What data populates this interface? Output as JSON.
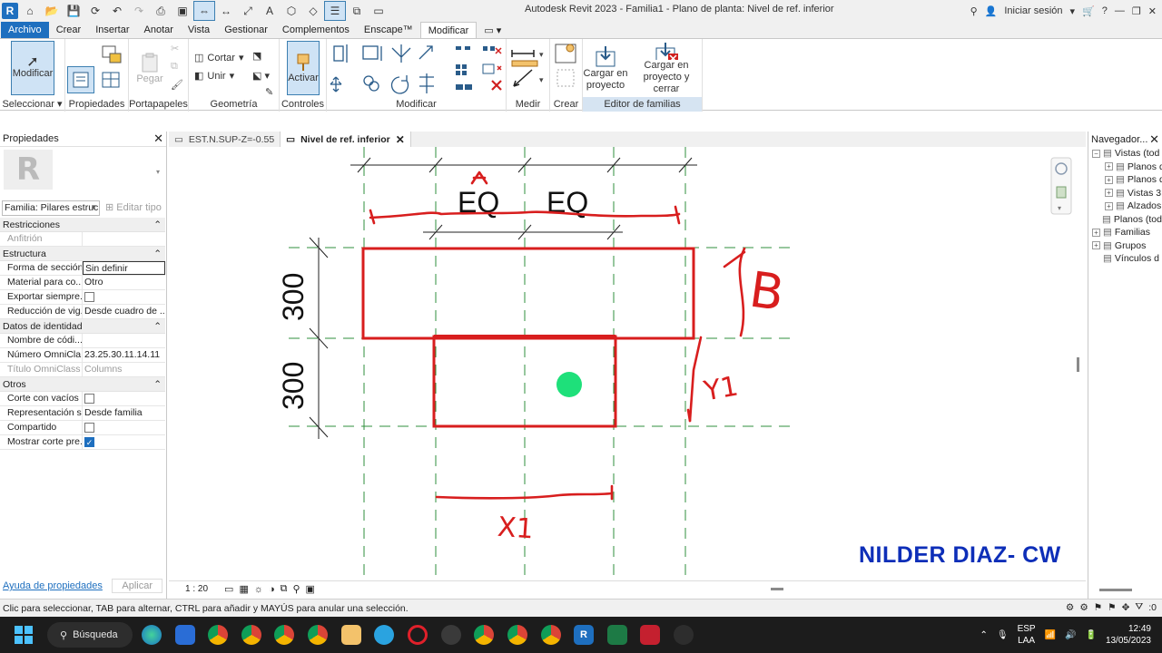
{
  "titlebar": {
    "title": "Autodesk Revit 2023 - Familia1 - Plano de planta: Nivel de ref. inferior",
    "signin": "Iniciar sesión",
    "help": "?"
  },
  "tabs": [
    "Archivo",
    "Crear",
    "Insertar",
    "Anotar",
    "Vista",
    "Gestionar",
    "Complementos",
    "Enscape™",
    "Modificar"
  ],
  "ribbon": {
    "modify_btn": "Modificar",
    "select_label": "Seleccionar",
    "properties_label": "Propiedades",
    "paste_label": "Pegar",
    "clipboard_label": "Portapapeles",
    "cut_label": "Cortar",
    "join_label": "Unir",
    "geometry_label": "Geometría",
    "activate_label": "Activar",
    "controls_label": "Controles",
    "modify_panel_label": "Modificar",
    "measure_label": "Medir",
    "create_label": "Crear",
    "load_project_line1": "Cargar en",
    "load_project_line2": "proyecto",
    "load_close_line1": "Cargar en",
    "load_close_line2": "proyecto y cerrar",
    "family_editor_label": "Editor de familias"
  },
  "properties": {
    "title": "Propiedades",
    "type_icon_letter": "R",
    "type_selector": "Familia: Pilares estruc",
    "edit_type": "Editar tipo",
    "groups": [
      {
        "name": "Restricciones",
        "rows": [
          {
            "name": "Anfitrión",
            "value": "",
            "disabled": true
          }
        ]
      },
      {
        "name": "Estructura",
        "rows": [
          {
            "name": "Forma de sección",
            "value": "Sin definir",
            "boxed": true
          },
          {
            "name": "Material para co...",
            "value": "Otro"
          },
          {
            "name": "Exportar siempre...",
            "check": false
          },
          {
            "name": "Reducción de vig...",
            "value": "Desde cuadro de ..."
          }
        ]
      },
      {
        "name": "Datos de identidad",
        "rows": [
          {
            "name": "Nombre de códi...",
            "value": ""
          },
          {
            "name": "Número OmniCla...",
            "value": "23.25.30.11.14.11"
          },
          {
            "name": "Título OmniClass",
            "value": "Columns",
            "disabled": true
          }
        ]
      },
      {
        "name": "Otros",
        "rows": [
          {
            "name": "Corte con vacíos ...",
            "check": false
          },
          {
            "name": "Representación s...",
            "value": "Desde familia"
          },
          {
            "name": "Compartido",
            "check": false
          },
          {
            "name": "Mostrar corte pre...",
            "check": true
          }
        ]
      }
    ],
    "help_link": "Ayuda de propiedades",
    "apply": "Aplicar"
  },
  "view_tabs": [
    {
      "label": "EST.N.SUP-Z=-0.55",
      "active": false
    },
    {
      "label": "Nivel de ref. inferior",
      "active": true
    }
  ],
  "canvas": {
    "dim_eq_1": "EQ",
    "dim_eq_2": "EQ",
    "dim_v_1": "300",
    "dim_v_2": "300",
    "note_b": "B",
    "note_y1": "Y1",
    "note_x1": "X1",
    "watermark": "NILDER DIAZ- CW",
    "colors": {
      "sketch": "#d81e1e",
      "ref_plane": "#2f8f3c",
      "dot": "#1ee07a",
      "watermark": "#0d2eb8"
    }
  },
  "view_control": {
    "scale": "1 : 20"
  },
  "browser": {
    "title": "Navegador...",
    "items": [
      {
        "label": "Vistas (tod",
        "expand": "-",
        "indent": 0
      },
      {
        "label": "Planos de",
        "expand": "+",
        "indent": 1
      },
      {
        "label": "Planos de",
        "expand": "+",
        "indent": 1
      },
      {
        "label": "Vistas 3D",
        "expand": "+",
        "indent": 1
      },
      {
        "label": "Alzados (",
        "expand": "+",
        "indent": 1
      },
      {
        "label": "Planos (tod",
        "expand": "",
        "indent": 0
      },
      {
        "label": "Familias",
        "expand": "+",
        "indent": 0
      },
      {
        "label": "Grupos",
        "expand": "+",
        "indent": 0
      },
      {
        "label": "Vínculos d",
        "expand": "",
        "indent": 0
      }
    ]
  },
  "statusbar": {
    "message": "Clic para seleccionar, TAB para alternar, CTRL para añadir y MAYÚS para anular una selección.",
    "filter_count": ":0"
  },
  "taskbar": {
    "search": "Búsqueda",
    "lang1": "ESP",
    "lang2": "LAA",
    "time": "12:49",
    "date": "13/05/2023"
  }
}
